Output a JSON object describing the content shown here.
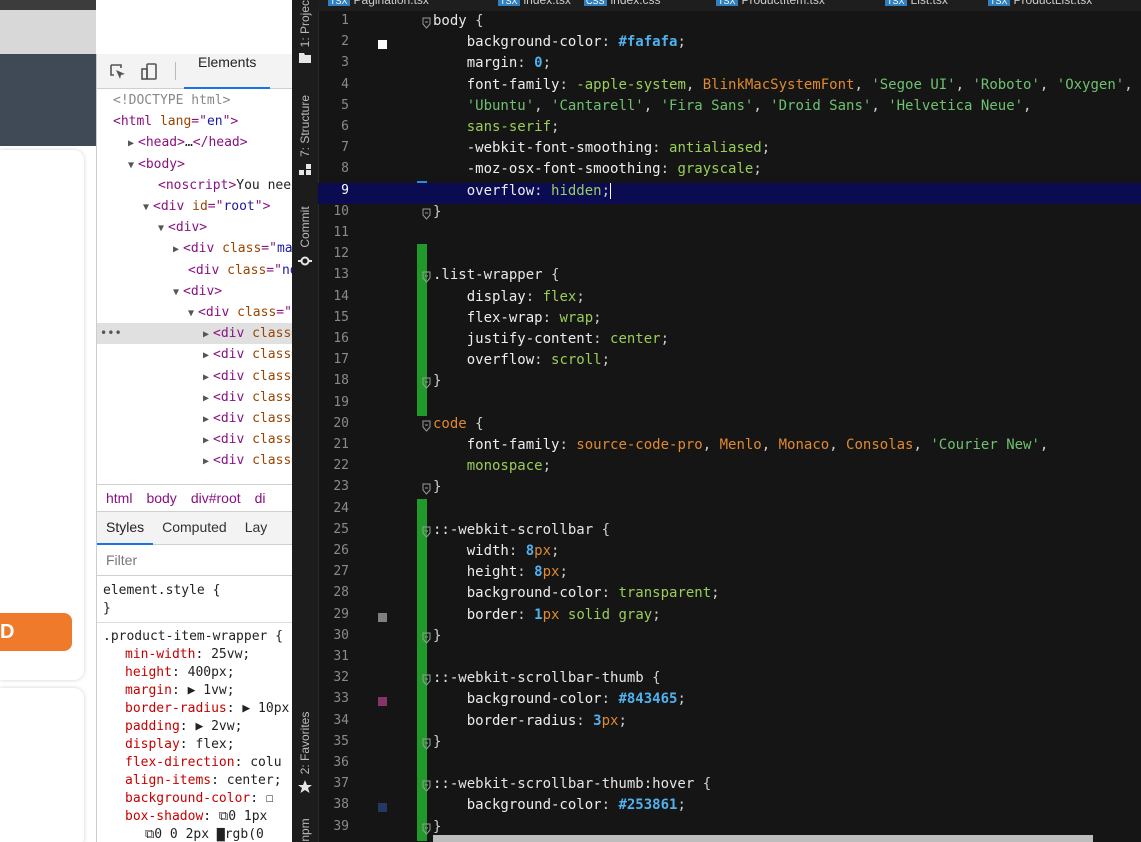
{
  "browser": {
    "button_label": "D"
  },
  "devtools": {
    "tab_elements": "Elements",
    "dom": [
      {
        "indent": 0,
        "tri": "",
        "parts": [
          [
            "doctype",
            "<!DOCTYPE html>"
          ]
        ]
      },
      {
        "indent": 0,
        "tri": "",
        "parts": [
          [
            "tag",
            "<html "
          ],
          [
            "attr",
            "lang"
          ],
          [
            "tag",
            "=\""
          ],
          [
            "val",
            "en"
          ],
          [
            "tag",
            "\">"
          ]
        ]
      },
      {
        "indent": 1,
        "tri": "▶",
        "parts": [
          [
            "tag",
            "<head>"
          ],
          [
            "txt",
            "…"
          ],
          [
            "tag",
            "</head>"
          ]
        ]
      },
      {
        "indent": 1,
        "tri": "▼",
        "parts": [
          [
            "tag",
            "<body>"
          ]
        ]
      },
      {
        "indent": 3,
        "tri": "",
        "parts": [
          [
            "tag",
            "<noscript>"
          ],
          [
            "txt",
            "You need"
          ]
        ]
      },
      {
        "indent": 2,
        "tri": "▼",
        "parts": [
          [
            "tag",
            "<div "
          ],
          [
            "attr",
            "id"
          ],
          [
            "tag",
            "=\""
          ],
          [
            "val",
            "root"
          ],
          [
            "tag",
            "\">"
          ]
        ]
      },
      {
        "indent": 3,
        "tri": "▼",
        "parts": [
          [
            "tag",
            "<div>"
          ]
        ]
      },
      {
        "indent": 4,
        "tri": "▶",
        "parts": [
          [
            "tag",
            "<div "
          ],
          [
            "attr",
            "class"
          ],
          [
            "tag",
            "=\""
          ],
          [
            "val",
            "ma"
          ]
        ]
      },
      {
        "indent": 5,
        "tri": "",
        "parts": [
          [
            "tag",
            "<div "
          ],
          [
            "attr",
            "class"
          ],
          [
            "tag",
            "=\""
          ],
          [
            "val",
            "no"
          ]
        ]
      },
      {
        "indent": 4,
        "tri": "▼",
        "parts": [
          [
            "tag",
            "<div>"
          ]
        ]
      },
      {
        "indent": 5,
        "tri": "▼",
        "parts": [
          [
            "tag",
            "<div "
          ],
          [
            "attr",
            "class"
          ],
          [
            "tag",
            "=\""
          ],
          [
            "val",
            "l"
          ]
        ]
      },
      {
        "indent": 6,
        "tri": "▶",
        "parts": [
          [
            "tag",
            "<div "
          ],
          [
            "attr",
            "class="
          ]
        ],
        "selected": true
      },
      {
        "indent": 6,
        "tri": "▶",
        "parts": [
          [
            "tag",
            "<div "
          ],
          [
            "attr",
            "class="
          ]
        ]
      },
      {
        "indent": 6,
        "tri": "▶",
        "parts": [
          [
            "tag",
            "<div "
          ],
          [
            "attr",
            "class="
          ]
        ]
      },
      {
        "indent": 6,
        "tri": "▶",
        "parts": [
          [
            "tag",
            "<div "
          ],
          [
            "attr",
            "class="
          ]
        ]
      },
      {
        "indent": 6,
        "tri": "▶",
        "parts": [
          [
            "tag",
            "<div "
          ],
          [
            "attr",
            "class="
          ]
        ]
      },
      {
        "indent": 6,
        "tri": "▶",
        "parts": [
          [
            "tag",
            "<div "
          ],
          [
            "attr",
            "class="
          ]
        ]
      },
      {
        "indent": 6,
        "tri": "▶",
        "parts": [
          [
            "tag",
            "<div "
          ],
          [
            "attr",
            "class="
          ]
        ]
      }
    ],
    "breadcrumb": [
      "html",
      "body",
      "div#root",
      "di"
    ],
    "subtabs": [
      "Styles",
      "Computed",
      "Lay"
    ],
    "filter_placeholder": "Filter",
    "styles": {
      "element_style_open": "element.style {",
      "element_style_close": "}",
      "rule_selector": ".product-item-wrapper {",
      "props": [
        {
          "name": "min-width",
          "value": "25vw;"
        },
        {
          "name": "height",
          "value": "400px;"
        },
        {
          "name": "margin",
          "value": "▶ 1vw;"
        },
        {
          "name": "border-radius",
          "value": "▶ 10px"
        },
        {
          "name": "padding",
          "value": "▶ 2vw;"
        },
        {
          "name": "display",
          "value": "flex;"
        },
        {
          "name": "flex-direction",
          "value": "colu"
        },
        {
          "name": "align-items",
          "value": "center;"
        },
        {
          "name": "background-color",
          "value": "☐"
        },
        {
          "name": "box-shadow",
          "value": "⧉0 1px"
        }
      ],
      "tail": "⧉0 0 2px ▇rgb(0"
    }
  },
  "ide": {
    "tabs": [
      {
        "badge": "TSX",
        "label": "Pagination.tsx"
      },
      {
        "badge": "TSX",
        "label": "index.tsx"
      },
      {
        "badge": "CSS",
        "label": "index.css",
        "active": true
      },
      {
        "badge": "TSX",
        "label": "ProductItem.tsx"
      },
      {
        "badge": "TSX",
        "label": "List.tsx"
      },
      {
        "badge": "TSX",
        "label": "ProductList.tsx"
      }
    ],
    "side_labels": [
      "1: Project",
      "7: Structure",
      "Commit",
      "2: Favorites",
      "npm"
    ],
    "current_line": 9,
    "lines": [
      {
        "n": "1",
        "fold": true,
        "t": [
          [
            "sel",
            "body "
          ],
          [
            "punc",
            "{"
          ]
        ]
      },
      {
        "n": "2",
        "swatch": "#fafafa",
        "t": [
          [
            "ind",
            "    "
          ],
          [
            "prop",
            "background-color"
          ],
          [
            "punc",
            ": "
          ],
          [
            "hex",
            "#fafafa"
          ],
          [
            "punc",
            ";"
          ]
        ]
      },
      {
        "n": "3",
        "t": [
          [
            "ind",
            "    "
          ],
          [
            "prop",
            "margin"
          ],
          [
            "punc",
            ": "
          ],
          [
            "num",
            "0"
          ],
          [
            "punc",
            ";"
          ]
        ]
      },
      {
        "n": "4",
        "t": [
          [
            "ind",
            "    "
          ],
          [
            "prop",
            "font-family"
          ],
          [
            "punc",
            ": "
          ],
          [
            "val",
            "-apple-system"
          ],
          [
            "punc",
            ", "
          ],
          [
            "kw",
            "BlinkMacSystemFont"
          ],
          [
            "punc",
            ", "
          ],
          [
            "str",
            "'Segoe UI'"
          ],
          [
            "punc",
            ", "
          ],
          [
            "str",
            "'Roboto'"
          ],
          [
            "punc",
            ", "
          ],
          [
            "str",
            "'Oxygen'"
          ],
          [
            "punc",
            ","
          ]
        ]
      },
      {
        "n": "5",
        "t": [
          [
            "ind",
            "    "
          ],
          [
            "str",
            "'Ubuntu'"
          ],
          [
            "punc",
            ", "
          ],
          [
            "str",
            "'Cantarell'"
          ],
          [
            "punc",
            ", "
          ],
          [
            "str",
            "'Fira Sans'"
          ],
          [
            "punc",
            ", "
          ],
          [
            "str",
            "'Droid Sans'"
          ],
          [
            "punc",
            ", "
          ],
          [
            "str",
            "'Helvetica Neue'"
          ],
          [
            "punc",
            ","
          ]
        ]
      },
      {
        "n": "6",
        "t": [
          [
            "ind",
            "    "
          ],
          [
            "val",
            "sans-serif"
          ],
          [
            "punc",
            ";"
          ]
        ]
      },
      {
        "n": "7",
        "t": [
          [
            "ind",
            "    "
          ],
          [
            "prop",
            "-webkit-font-smoothing"
          ],
          [
            "punc",
            ": "
          ],
          [
            "val",
            "antialiased"
          ],
          [
            "punc",
            ";"
          ]
        ]
      },
      {
        "n": "8",
        "t": [
          [
            "ind",
            "    "
          ],
          [
            "prop",
            "-moz-osx-font-smoothing"
          ],
          [
            "punc",
            ": "
          ],
          [
            "val",
            "grayscale"
          ],
          [
            "punc",
            ";"
          ]
        ]
      },
      {
        "n": "9",
        "t": [
          [
            "ind",
            "    "
          ],
          [
            "prop",
            "overflow"
          ],
          [
            "punc",
            ": "
          ],
          [
            "val",
            "hidden"
          ],
          [
            "punc",
            ";"
          ]
        ],
        "caret": true
      },
      {
        "n": "10",
        "fold": true,
        "t": [
          [
            "punc",
            "}"
          ]
        ]
      },
      {
        "n": "11",
        "t": []
      },
      {
        "n": "12",
        "t": []
      },
      {
        "n": "13",
        "fold": true,
        "t": [
          [
            "sel",
            ".list-wrapper "
          ],
          [
            "punc",
            "{"
          ]
        ]
      },
      {
        "n": "14",
        "t": [
          [
            "ind",
            "    "
          ],
          [
            "prop",
            "display"
          ],
          [
            "punc",
            ": "
          ],
          [
            "val",
            "flex"
          ],
          [
            "punc",
            ";"
          ]
        ]
      },
      {
        "n": "15",
        "t": [
          [
            "ind",
            "    "
          ],
          [
            "prop",
            "flex-wrap"
          ],
          [
            "punc",
            ": "
          ],
          [
            "val",
            "wrap"
          ],
          [
            "punc",
            ";"
          ]
        ]
      },
      {
        "n": "16",
        "t": [
          [
            "ind",
            "    "
          ],
          [
            "prop",
            "justify-content"
          ],
          [
            "punc",
            ": "
          ],
          [
            "val",
            "center"
          ],
          [
            "punc",
            ";"
          ]
        ]
      },
      {
        "n": "17",
        "t": [
          [
            "ind",
            "    "
          ],
          [
            "prop",
            "overflow"
          ],
          [
            "punc",
            ": "
          ],
          [
            "val",
            "scroll"
          ],
          [
            "punc",
            ";"
          ]
        ]
      },
      {
        "n": "18",
        "fold": true,
        "t": [
          [
            "punc",
            "}"
          ]
        ]
      },
      {
        "n": "19",
        "t": []
      },
      {
        "n": "20",
        "fold": true,
        "t": [
          [
            "kw",
            "code "
          ],
          [
            "punc",
            "{"
          ]
        ]
      },
      {
        "n": "21",
        "t": [
          [
            "ind",
            "    "
          ],
          [
            "prop",
            "font-family"
          ],
          [
            "punc",
            ": "
          ],
          [
            "kw",
            "source-code-pro"
          ],
          [
            "punc",
            ", "
          ],
          [
            "kw",
            "Menlo"
          ],
          [
            "punc",
            ", "
          ],
          [
            "kw",
            "Monaco"
          ],
          [
            "punc",
            ", "
          ],
          [
            "kw",
            "Consolas"
          ],
          [
            "punc",
            ", "
          ],
          [
            "str",
            "'Courier New'"
          ],
          [
            "punc",
            ","
          ]
        ]
      },
      {
        "n": "22",
        "t": [
          [
            "ind",
            "    "
          ],
          [
            "val",
            "monospace"
          ],
          [
            "punc",
            ";"
          ]
        ]
      },
      {
        "n": "23",
        "fold": true,
        "t": [
          [
            "punc",
            "}"
          ]
        ]
      },
      {
        "n": "24",
        "t": []
      },
      {
        "n": "25",
        "fold": true,
        "t": [
          [
            "sel",
            "::-webkit-scrollbar "
          ],
          [
            "punc",
            "{"
          ]
        ]
      },
      {
        "n": "26",
        "t": [
          [
            "ind",
            "    "
          ],
          [
            "prop",
            "width"
          ],
          [
            "punc",
            ": "
          ],
          [
            "num",
            "8"
          ],
          [
            "unit",
            "px"
          ],
          [
            "punc",
            ";"
          ]
        ]
      },
      {
        "n": "27",
        "t": [
          [
            "ind",
            "    "
          ],
          [
            "prop",
            "height"
          ],
          [
            "punc",
            ": "
          ],
          [
            "num",
            "8"
          ],
          [
            "unit",
            "px"
          ],
          [
            "punc",
            ";"
          ]
        ]
      },
      {
        "n": "28",
        "t": [
          [
            "ind",
            "    "
          ],
          [
            "prop",
            "background-color"
          ],
          [
            "punc",
            ": "
          ],
          [
            "val",
            "transparent"
          ],
          [
            "punc",
            ";"
          ]
        ]
      },
      {
        "n": "29",
        "swatch": "#808080",
        "t": [
          [
            "ind",
            "    "
          ],
          [
            "prop",
            "border"
          ],
          [
            "punc",
            ": "
          ],
          [
            "num",
            "1"
          ],
          [
            "unit",
            "px"
          ],
          [
            "punc",
            " "
          ],
          [
            "val",
            "solid gray"
          ],
          [
            "punc",
            ";"
          ]
        ]
      },
      {
        "n": "30",
        "fold": true,
        "t": [
          [
            "punc",
            "}"
          ]
        ]
      },
      {
        "n": "31",
        "t": []
      },
      {
        "n": "32",
        "fold": true,
        "t": [
          [
            "sel",
            "::-webkit-scrollbar-thumb "
          ],
          [
            "punc",
            "{"
          ]
        ]
      },
      {
        "n": "33",
        "swatch": "#843465",
        "t": [
          [
            "ind",
            "    "
          ],
          [
            "prop",
            "background-color"
          ],
          [
            "punc",
            ": "
          ],
          [
            "hex",
            "#843465"
          ],
          [
            "punc",
            ";"
          ]
        ]
      },
      {
        "n": "34",
        "t": [
          [
            "ind",
            "    "
          ],
          [
            "prop",
            "border-radius"
          ],
          [
            "punc",
            ": "
          ],
          [
            "num",
            "3"
          ],
          [
            "unit",
            "px"
          ],
          [
            "punc",
            ";"
          ]
        ]
      },
      {
        "n": "35",
        "fold": true,
        "t": [
          [
            "punc",
            "}"
          ]
        ]
      },
      {
        "n": "36",
        "t": []
      },
      {
        "n": "37",
        "fold": true,
        "t": [
          [
            "sel",
            "::-webkit-scrollbar-thumb:hover "
          ],
          [
            "punc",
            "{"
          ]
        ]
      },
      {
        "n": "38",
        "swatch": "#253861",
        "t": [
          [
            "ind",
            "    "
          ],
          [
            "prop",
            "background-color"
          ],
          [
            "punc",
            ": "
          ],
          [
            "hex",
            "#253861"
          ],
          [
            "punc",
            ";"
          ]
        ]
      },
      {
        "n": "39",
        "fold": true,
        "t": [
          [
            "punc",
            "}"
          ]
        ]
      }
    ]
  }
}
